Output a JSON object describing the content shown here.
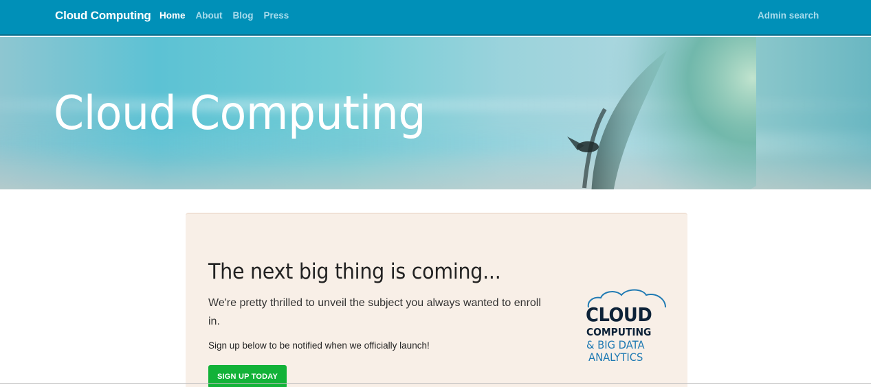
{
  "navbar": {
    "brand": "Cloud Computing",
    "links": [
      {
        "label": "Home",
        "active": true
      },
      {
        "label": "About",
        "active": false
      },
      {
        "label": "Blog",
        "active": false
      },
      {
        "label": "Press",
        "active": false
      }
    ],
    "admin_label": "Admin search"
  },
  "hero": {
    "title": "Cloud Computing"
  },
  "card": {
    "heading": "The next big thing is coming...",
    "lead": "We're pretty thrilled to unveil the subject you always wanted to enroll in.",
    "note": "Sign up below to be notified when we officially launch!",
    "button_label": "SIGN UP TODAY"
  },
  "logo": {
    "line1": "CLOUD",
    "line2": "COMPUTING",
    "line3": "& BIG DATA",
    "line4": "ANALYTICS"
  },
  "colors": {
    "navbar": "#0090b8",
    "card_background": "#f8efe7",
    "button": "#12b238",
    "logo_dark": "#0d2238",
    "logo_blue": "#1f7ab3"
  }
}
